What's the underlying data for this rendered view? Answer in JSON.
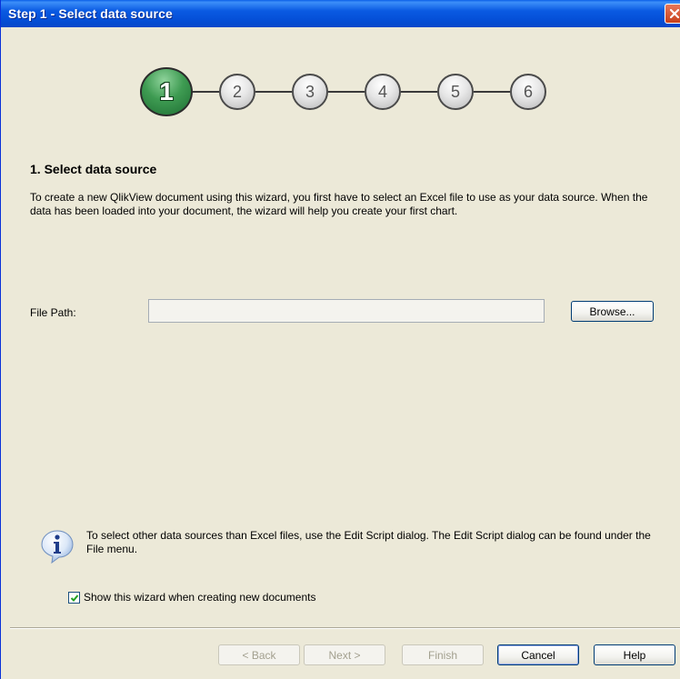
{
  "window": {
    "title": "Step 1 - Select data source",
    "close_icon": "close-icon"
  },
  "steps": [
    {
      "number": "1",
      "state": "active"
    },
    {
      "number": "2",
      "state": "inactive"
    },
    {
      "number": "3",
      "state": "inactive"
    },
    {
      "number": "4",
      "state": "inactive"
    },
    {
      "number": "5",
      "state": "inactive"
    },
    {
      "number": "6",
      "state": "inactive"
    }
  ],
  "main": {
    "heading": "1. Select data source",
    "description": "To create a new QlikView document using this wizard, you first have to select an Excel file to use as your data source. When the data has been loaded into your document, the wizard will help you create your first chart.",
    "file_path_label": "File Path:",
    "file_path_value": "",
    "browse_label": "Browse..."
  },
  "info": {
    "icon": "info-icon",
    "text": "To select other data sources than Excel files, use the Edit Script dialog. The Edit Script dialog can be found under the File menu."
  },
  "show_wizard": {
    "label": "Show this wizard when creating new documents",
    "checked": true
  },
  "footer": {
    "back_label": "< Back",
    "next_label": "Next >",
    "finish_label": "Finish",
    "cancel_label": "Cancel",
    "help_label": "Help"
  },
  "colors": {
    "titlebar": "#0a5ae2",
    "active_step": "#3e9b52",
    "dialog_bg": "#ece9d8"
  }
}
